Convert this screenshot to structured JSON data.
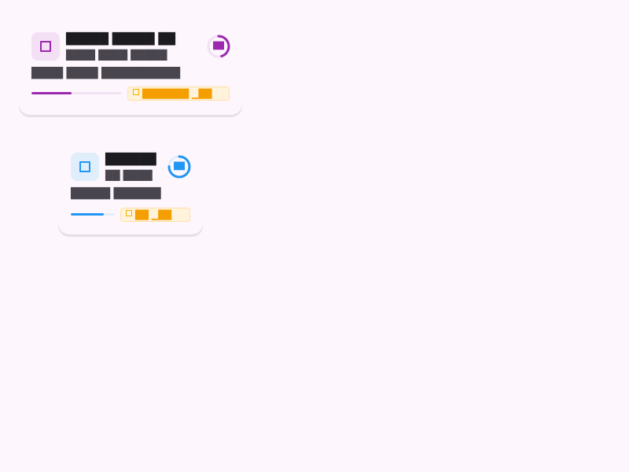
{
  "colors": {
    "background": "#fdf6fd",
    "badge_text": "#f59e00"
  },
  "cards": [
    {
      "icon": "square-icon",
      "accent": "#9c27b0",
      "icon_bg": "#f3e0f5",
      "track": "#f1e1f3",
      "title": "█████ █████ ██",
      "subtitle": "████ ████ █████",
      "description": "████ ████ ██████████",
      "progress_percent": 45,
      "ring_percent": 45,
      "ring_label": "██",
      "badge_icon": "square-icon",
      "badge_text": "███████ ▁██"
    },
    {
      "icon": "square-icon",
      "accent": "#2196f3",
      "icon_bg": "#e0eefc",
      "track": "#e3eefa",
      "title": "██████",
      "subtitle": "██ ████",
      "description": "█████ ██████",
      "progress_percent": 75,
      "ring_percent": 75,
      "ring_label": "██",
      "badge_icon": "square-icon",
      "badge_text": "██ ▁██"
    }
  ]
}
